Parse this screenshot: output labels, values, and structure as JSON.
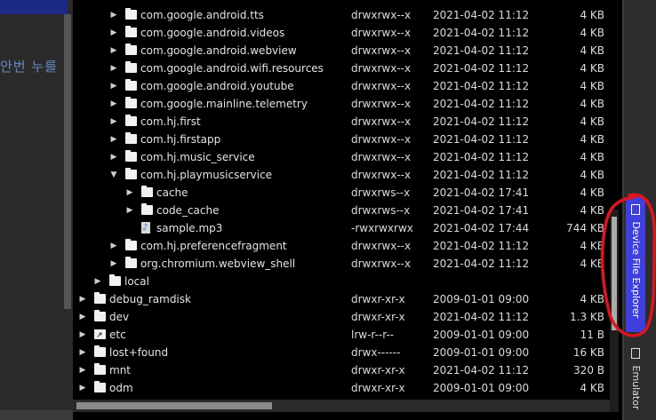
{
  "left_pane": {
    "hint_text": "안번 누를"
  },
  "explorer": {
    "rows": [
      {
        "indent": 2,
        "arrow": "right",
        "icon": "folder",
        "name": "com.google.android.tts",
        "perm": "drwxrwx--x",
        "date": "2021-04-02 11:12",
        "size": "4 KB"
      },
      {
        "indent": 2,
        "arrow": "right",
        "icon": "folder",
        "name": "com.google.android.videos",
        "perm": "drwxrwx--x",
        "date": "2021-04-02 11:12",
        "size": "4 KB"
      },
      {
        "indent": 2,
        "arrow": "right",
        "icon": "folder",
        "name": "com.google.android.webview",
        "perm": "drwxrwx--x",
        "date": "2021-04-02 11:12",
        "size": "4 KB"
      },
      {
        "indent": 2,
        "arrow": "right",
        "icon": "folder",
        "name": "com.google.android.wifi.resources",
        "perm": "drwxrwx--x",
        "date": "2021-04-02 11:12",
        "size": "4 KB"
      },
      {
        "indent": 2,
        "arrow": "right",
        "icon": "folder",
        "name": "com.google.android.youtube",
        "perm": "drwxrwx--x",
        "date": "2021-04-02 11:12",
        "size": "4 KB"
      },
      {
        "indent": 2,
        "arrow": "right",
        "icon": "folder",
        "name": "com.google.mainline.telemetry",
        "perm": "drwxrwx--x",
        "date": "2021-04-02 11:12",
        "size": "4 KB"
      },
      {
        "indent": 2,
        "arrow": "right",
        "icon": "folder",
        "name": "com.hj.first",
        "perm": "drwxrwx--x",
        "date": "2021-04-02 11:12",
        "size": "4 KB"
      },
      {
        "indent": 2,
        "arrow": "right",
        "icon": "folder",
        "name": "com.hj.firstapp",
        "perm": "drwxrwx--x",
        "date": "2021-04-02 11:12",
        "size": "4 KB"
      },
      {
        "indent": 2,
        "arrow": "right",
        "icon": "folder",
        "name": "com.hj.music_service",
        "perm": "drwxrwx--x",
        "date": "2021-04-02 11:12",
        "size": "4 KB"
      },
      {
        "indent": 2,
        "arrow": "down",
        "icon": "folder",
        "name": "com.hj.playmusicservice",
        "perm": "drwxrwx--x",
        "date": "2021-04-02 11:12",
        "size": "4 KB"
      },
      {
        "indent": 3,
        "arrow": "right",
        "icon": "folder",
        "name": "cache",
        "perm": "drwxrws--x",
        "date": "2021-04-02 17:41",
        "size": "4 KB"
      },
      {
        "indent": 3,
        "arrow": "right",
        "icon": "folder",
        "name": "code_cache",
        "perm": "drwxrws--x",
        "date": "2021-04-02 17:41",
        "size": "4 KB"
      },
      {
        "indent": 3,
        "arrow": "none",
        "icon": "file",
        "name": "sample.mp3",
        "perm": "-rwxrwxrwx",
        "date": "2021-04-02 17:44",
        "size": "744 KB"
      },
      {
        "indent": 2,
        "arrow": "right",
        "icon": "folder",
        "name": "com.hj.preferencefragment",
        "perm": "drwxrwx--x",
        "date": "2021-04-02 11:12",
        "size": "4 KB"
      },
      {
        "indent": 2,
        "arrow": "right",
        "icon": "folder",
        "name": "org.chromium.webview_shell",
        "perm": "drwxrwx--x",
        "date": "2021-04-02 11:12",
        "size": "4 KB"
      },
      {
        "indent": 1,
        "arrow": "right",
        "icon": "folder",
        "name": "local",
        "perm": "",
        "date": "",
        "size": ""
      },
      {
        "indent": 0,
        "arrow": "right",
        "icon": "folder",
        "name": "debug_ramdisk",
        "perm": "drwxr-xr-x",
        "date": "2009-01-01 09:00",
        "size": "4 KB"
      },
      {
        "indent": 0,
        "arrow": "right",
        "icon": "folder",
        "name": "dev",
        "perm": "drwxr-xr-x",
        "date": "2021-04-02 11:12",
        "size": "1.3 KB"
      },
      {
        "indent": 0,
        "arrow": "right",
        "icon": "link",
        "name": "etc",
        "perm": "lrw-r--r--",
        "date": "2009-01-01 09:00",
        "size": "11 B"
      },
      {
        "indent": 0,
        "arrow": "right",
        "icon": "folder",
        "name": "lost+found",
        "perm": "drwx------",
        "date": "2009-01-01 09:00",
        "size": "16 KB"
      },
      {
        "indent": 0,
        "arrow": "right",
        "icon": "folder",
        "name": "mnt",
        "perm": "drwxr-xr-x",
        "date": "2021-04-02 11:12",
        "size": "320 B"
      },
      {
        "indent": 0,
        "arrow": "right",
        "icon": "folder",
        "name": "odm",
        "perm": "drwxr-xr-x",
        "date": "2009-01-01 09:00",
        "size": "4 KB"
      }
    ]
  },
  "side_tabs": {
    "device_file_explorer": "Device File Explorer",
    "emulator": "Emulator"
  },
  "colors": {
    "tab_active": "#3f3fe0",
    "annotation": "#e0141e"
  }
}
